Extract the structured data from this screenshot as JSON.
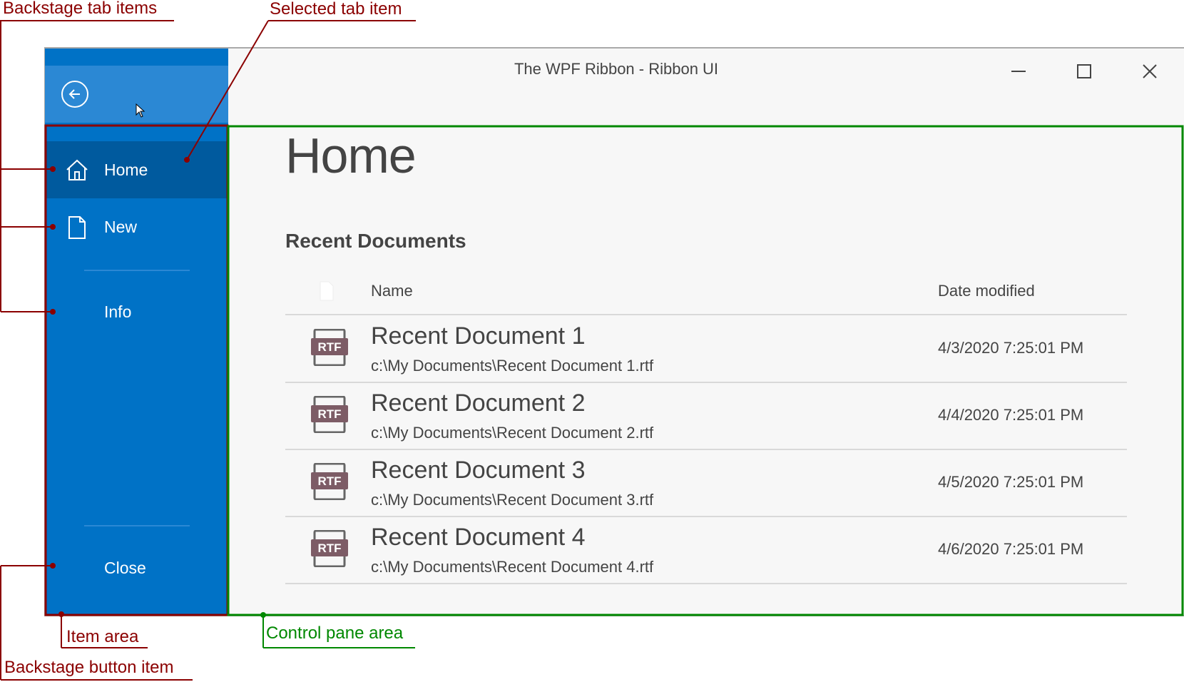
{
  "window": {
    "title": "The WPF Ribbon - Ribbon UI",
    "controls": [
      "minimize",
      "maximize",
      "close"
    ]
  },
  "backstage": {
    "back_button_icon": "back-arrow-circle-icon",
    "tabs": [
      {
        "label": "Home",
        "icon": "home-icon",
        "selected": true
      },
      {
        "label": "New",
        "icon": "new-document-icon",
        "selected": false
      },
      {
        "label": "Info",
        "icon": "",
        "selected": false
      }
    ],
    "button_item": {
      "label": "Close"
    }
  },
  "content": {
    "heading": "Home",
    "section_title": "Recent Documents",
    "columns": {
      "icon": "document-icon",
      "name": "Name",
      "date": "Date modified"
    },
    "documents": [
      {
        "name": "Recent Document 1",
        "path": "c:\\My Documents\\Recent Document 1.rtf",
        "date": "4/3/2020 7:25:01 PM",
        "type": "RTF"
      },
      {
        "name": "Recent Document 2",
        "path": "c:\\My Documents\\Recent Document 2.rtf",
        "date": "4/4/2020 7:25:01 PM",
        "type": "RTF"
      },
      {
        "name": "Recent Document 3",
        "path": "c:\\My Documents\\Recent Document 3.rtf",
        "date": "4/5/2020 7:25:01 PM",
        "type": "RTF"
      },
      {
        "name": "Recent Document 4",
        "path": "c:\\My Documents\\Recent Document 4.rtf",
        "date": "4/6/2020 7:25:01 PM",
        "type": "RTF"
      }
    ]
  },
  "annotations": {
    "backstage_tab_items": "Backstage tab items",
    "selected_tab_item": "Selected tab item",
    "item_area": "Item area",
    "backstage_button_item": "Backstage button item",
    "control_pane_area": "Control pane area"
  },
  "colors": {
    "sidebar": "#0072c6",
    "sidebar_selected": "#005a9e",
    "back_area": "#2b88d4",
    "rtf_badge": "#7d5c66",
    "annotation_red": "#8b0000",
    "annotation_green": "#008800"
  }
}
